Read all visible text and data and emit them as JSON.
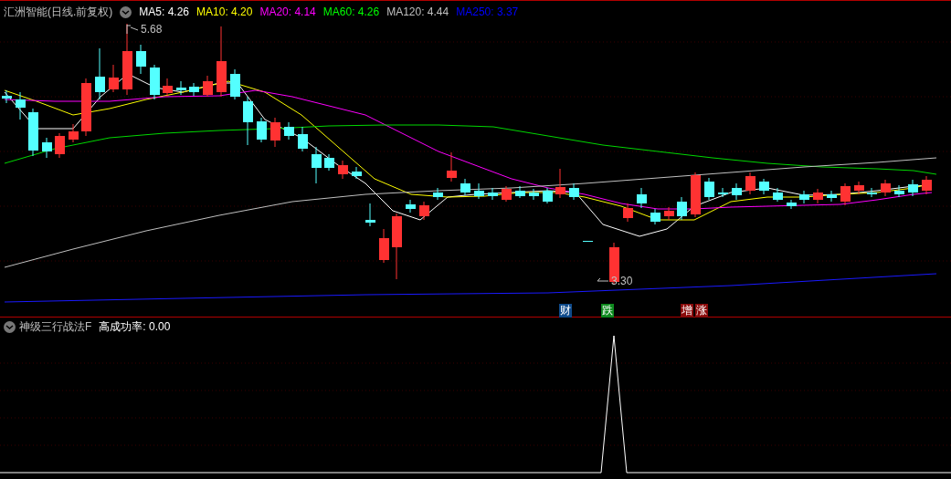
{
  "main_chart": {
    "title": "汇洲智能(日线.前复权)",
    "moving_averages": [
      {
        "text": "MA5: 4.26",
        "color": "#ffffff"
      },
      {
        "text": "MA10: 4.20",
        "color": "#ffff00"
      },
      {
        "text": "MA20: 4.14",
        "color": "#ff00ff"
      },
      {
        "text": "MA60: 4.26",
        "color": "#00ff00"
      },
      {
        "text": "MA120: 4.44",
        "color": "#c0c0c0"
      },
      {
        "text": "MA250: 3.37",
        "color": "#0000ff"
      }
    ],
    "high_label": "5.68",
    "low_label": "3.30",
    "event_badges": [
      {
        "text": "财",
        "color": "#0f4a8a"
      },
      {
        "text": "跌",
        "color": "#0e8a1e"
      },
      {
        "text": "增",
        "color": "#8a0b0b"
      },
      {
        "text": "涨",
        "color": "#8a0b0b"
      }
    ]
  },
  "indicator": {
    "name": "神级三行战法F",
    "reading": "高成功率: 0.00"
  }
}
